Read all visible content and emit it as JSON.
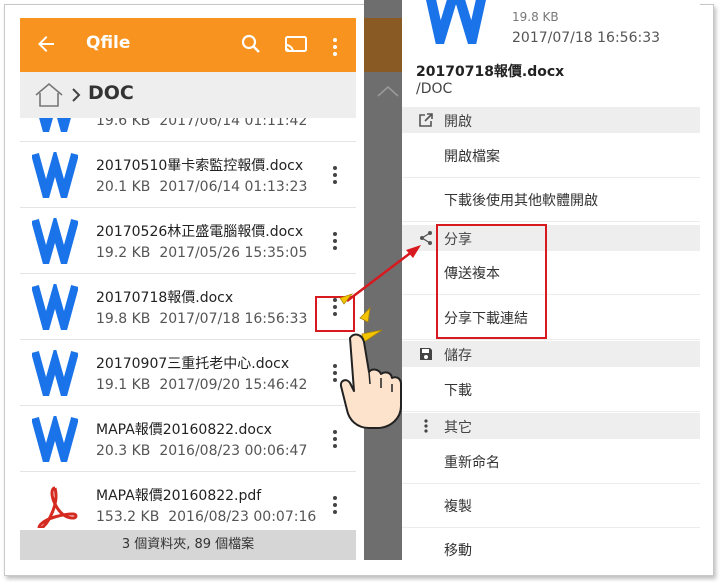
{
  "app": {
    "title": "Qfile",
    "colors": {
      "accent": "#f7931e",
      "word_blue": "#1a73e8",
      "pdf_red": "#d42a20",
      "highlight_red": "#d71920"
    }
  },
  "breadcrumb": {
    "path": "DOC"
  },
  "files": [
    {
      "name": "",
      "size": "19.6 KB",
      "date": "2017/06/14 01:11:42",
      "icon": "word-icon"
    },
    {
      "name": "20170510畢卡索監控報價.docx",
      "size": "20.1 KB",
      "date": "2017/06/14 01:13:23",
      "icon": "word-icon"
    },
    {
      "name": "20170526林正盛電腦報價.docx",
      "size": "19.2 KB",
      "date": "2017/05/26 15:35:05",
      "icon": "word-icon"
    },
    {
      "name": "20170718報價.docx",
      "size": "19.8 KB",
      "date": "2017/07/18 16:56:33",
      "icon": "word-icon"
    },
    {
      "name": "20170907三重托老中心.docx",
      "size": "19.1 KB",
      "date": "2017/09/20 15:46:42",
      "icon": "word-icon"
    },
    {
      "name": "MAPA報價20160822.docx",
      "size": "20.3 KB",
      "date": "2016/08/23 00:06:47",
      "icon": "word-icon"
    },
    {
      "name": "MAPA報價20160822.pdf",
      "size": "153.2 KB",
      "date": "2016/08/23 00:07:16",
      "icon": "pdf-icon"
    }
  ],
  "footer": {
    "summary": "3 個資料夾, 89 個檔案"
  },
  "sheet": {
    "top_size": "19.8 KB",
    "top_date": "2017/07/18 16:56:33",
    "file_name": "20170718報價.docx",
    "file_path": "/DOC",
    "sections": [
      {
        "title": "開啟",
        "icon": "open-external-icon",
        "actions": [
          "開啟檔案",
          "下載後使用其他軟體開啟"
        ]
      },
      {
        "title": "分享",
        "icon": "share-icon",
        "actions": [
          "傳送複本",
          "分享下載連結"
        ]
      },
      {
        "title": "儲存",
        "icon": "save-icon",
        "actions": [
          "下載"
        ]
      },
      {
        "title": "其它",
        "icon": "more-vert-icon",
        "actions": [
          "重新命名",
          "複製",
          "移動"
        ]
      }
    ]
  }
}
